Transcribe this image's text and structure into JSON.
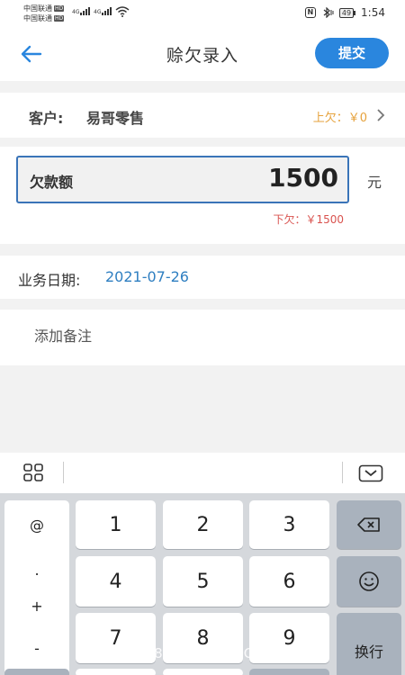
{
  "status_bar": {
    "carrier1": "中国联通",
    "carrier2": "中国联通",
    "hd_badge": "HD",
    "signal_label": "4G",
    "signal2_label": "4G",
    "battery": "49",
    "time": "1:54"
  },
  "header": {
    "title": "赊欠录入",
    "submit_label": "提交"
  },
  "customer": {
    "label": "客户:",
    "name": "易哥零售",
    "previous_debt": "上欠：￥0"
  },
  "amount": {
    "label": "欠款额",
    "value": "1500",
    "unit": "元",
    "next_debt": "下欠：￥1500"
  },
  "date": {
    "label": "业务日期:",
    "value": "2021-07-26"
  },
  "note": {
    "placeholder": "添加备注"
  },
  "keyboard": {
    "symbols": [
      "@",
      ".",
      "+",
      "-"
    ],
    "keys": [
      "1",
      "2",
      "3",
      "4",
      "5",
      "6",
      "7",
      "8",
      "9"
    ],
    "enter_label": "换行"
  },
  "watermark": "手游5588 • MX5588.COM",
  "colors": {
    "accent": "#2a86de",
    "previous_debt": "#e6a23c",
    "next_debt": "#d9534f",
    "date": "#2f7fc1",
    "input_border": "#3a74b8"
  }
}
